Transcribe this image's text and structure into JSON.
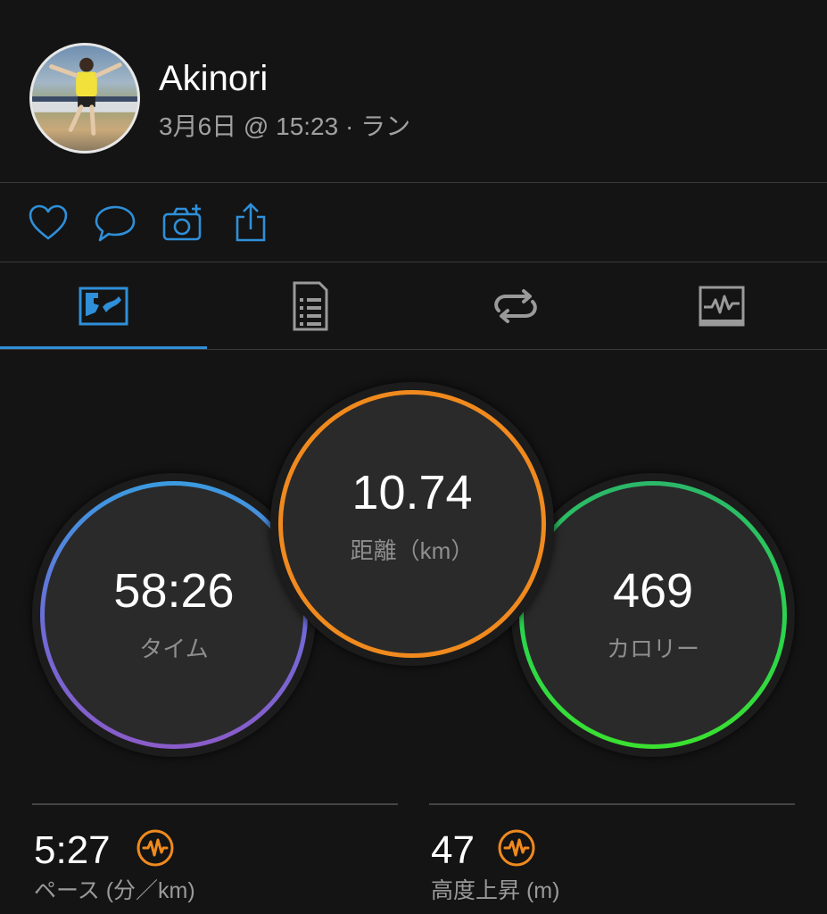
{
  "header": {
    "user_name": "Akinori",
    "activity_meta": "3月6日 @ 15:23 · ラン"
  },
  "actions": [
    {
      "name": "like",
      "icon": "heart-icon"
    },
    {
      "name": "comment",
      "icon": "comment-icon"
    },
    {
      "name": "add-photo",
      "icon": "camera-plus-icon"
    },
    {
      "name": "share",
      "icon": "share-icon"
    }
  ],
  "tabs": [
    {
      "name": "overview",
      "icon": "overview-map-icon",
      "active": true
    },
    {
      "name": "stats",
      "icon": "document-list-icon",
      "active": false
    },
    {
      "name": "laps",
      "icon": "laps-icon",
      "active": false
    },
    {
      "name": "charts",
      "icon": "chart-icon",
      "active": false
    }
  ],
  "metrics": {
    "time": {
      "value": "58:26",
      "label": "タイム"
    },
    "distance": {
      "value": "10.74",
      "label": "距離（km）"
    },
    "calories": {
      "value": "469",
      "label": "カロリー"
    }
  },
  "stats": {
    "pace": {
      "value": "5:27",
      "label": "ペース (分／km)"
    },
    "elevation": {
      "value": "47",
      "label": "高度上昇 (m)"
    }
  },
  "colors": {
    "background": "#141414",
    "accent_blue": "#2f8fd8",
    "distance_ring": "#f08a1e",
    "calorie_ring": "#2bd64a",
    "badge": "#f08a1e"
  }
}
